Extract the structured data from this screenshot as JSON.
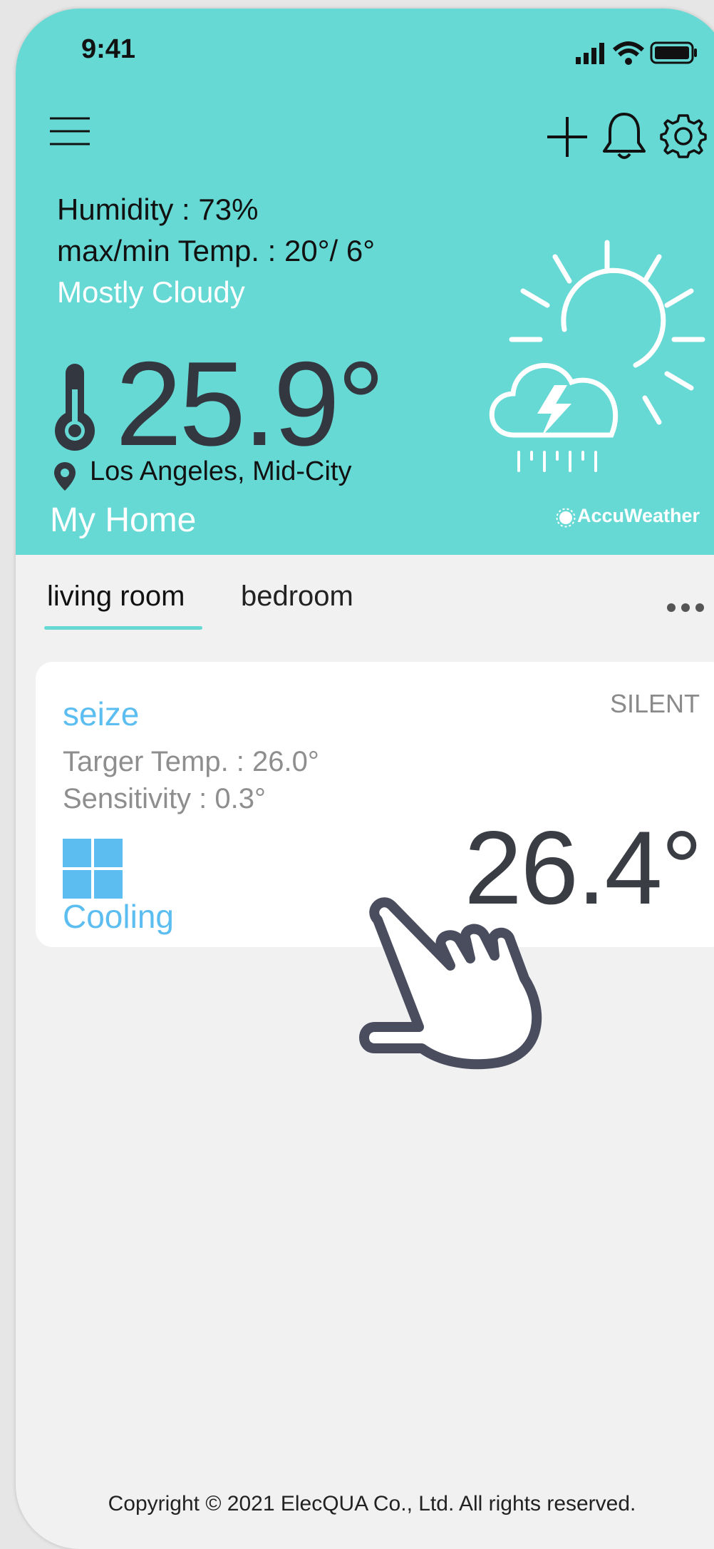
{
  "status_bar": {
    "time": "9:41"
  },
  "weather": {
    "humidity": "Humidity : 73%",
    "max_min_temp": "max/min Temp. : 20°/ 6°",
    "condition": "Mostly Cloudy",
    "temperature": "25.9°",
    "location": "Los Angeles, Mid-City",
    "home_name": "My Home",
    "provider": "AccuWeather",
    "icon": "sun-storm-cloud-icon"
  },
  "tabs": [
    {
      "label": "living room",
      "active": true
    },
    {
      "label": "bedroom",
      "active": false
    }
  ],
  "device_card": {
    "name": "seize",
    "mode": "SILENT",
    "target_temp": "Targer Temp. : 26.0°",
    "sensitivity": "Sensitivity : 0.3°",
    "current_temp": "26.4°",
    "status": "Cooling",
    "mode_icon": "window-grid-icon"
  },
  "footer": {
    "copyright": "Copyright © 2021 ElecQUA Co., Ltd. All rights reserved."
  },
  "colors": {
    "header_bg": "#66d9d4",
    "accent_blue": "#5cbef0",
    "page_bg": "#f1f1f2"
  }
}
